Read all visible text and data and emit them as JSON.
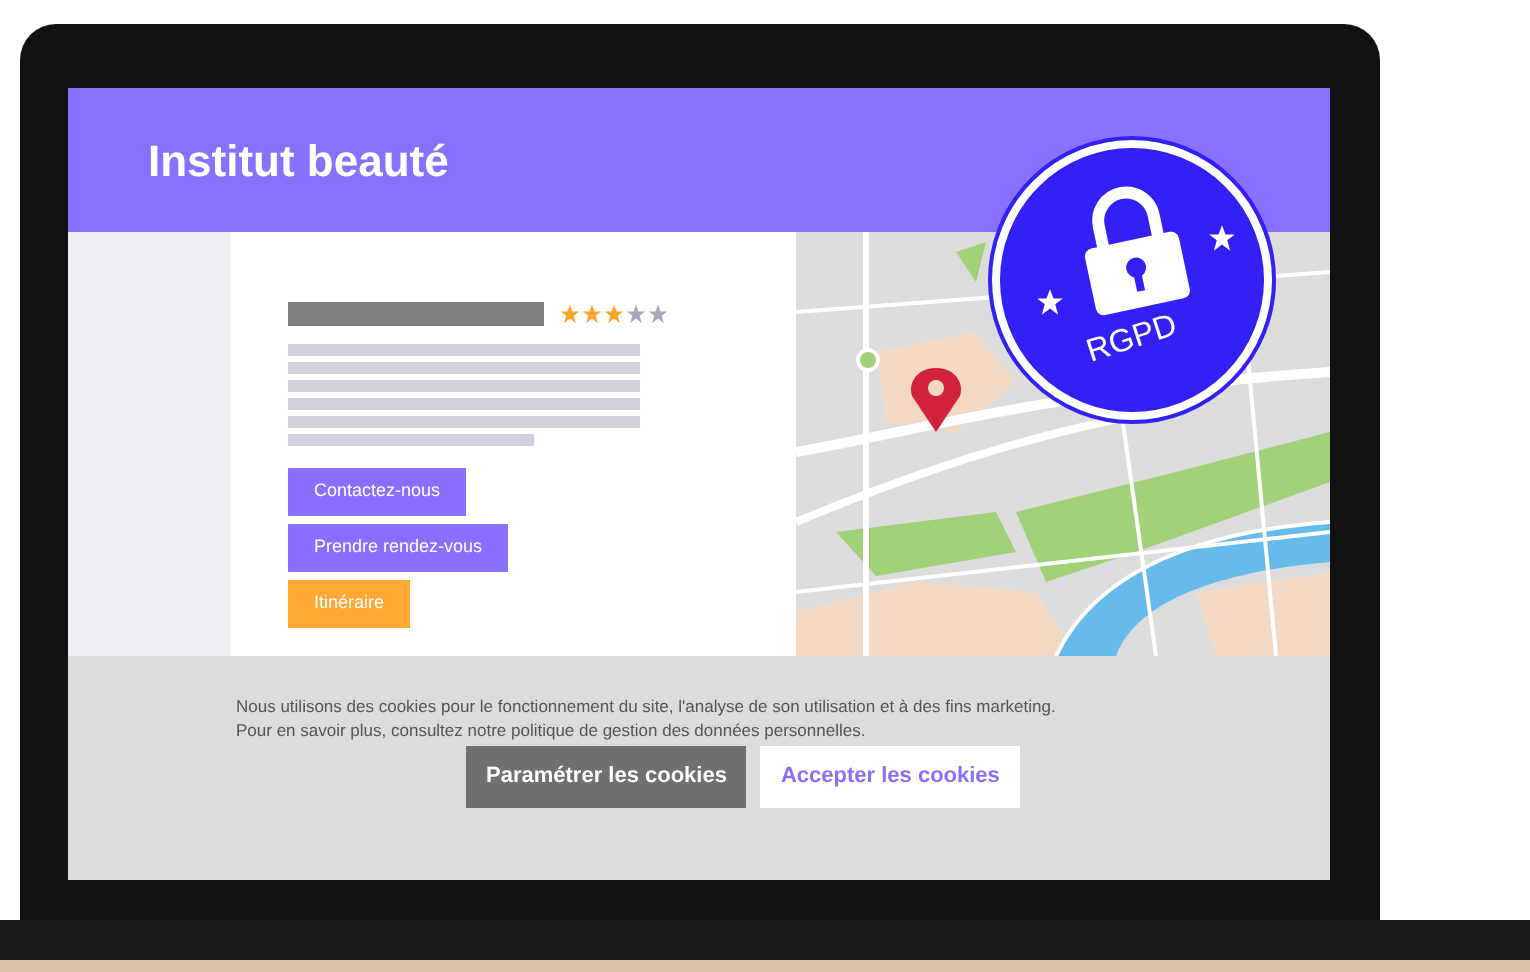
{
  "header": {
    "title": "Institut beauté"
  },
  "listing": {
    "stars": 3,
    "buttons": [
      {
        "label": "Contactez-nous",
        "kind": "primary"
      },
      {
        "label": "Prendre rendez-vous",
        "kind": "primary"
      },
      {
        "label": "Itinéraire",
        "kind": "accent"
      }
    ]
  },
  "badge": {
    "label": "RGPD"
  },
  "cookie_banner": {
    "text": "Nous utilisons des cookies pour le fonctionnement du site, l'analyse de son utilisation et à des fins marketing.  Pour en savoir plus, consultez notre politique de gestion des données personnelles.",
    "buttons": [
      {
        "label": "Paramétrer les cookies",
        "kind": "secondary"
      },
      {
        "label": "Accepter les cookies",
        "kind": "primary"
      }
    ]
  }
}
